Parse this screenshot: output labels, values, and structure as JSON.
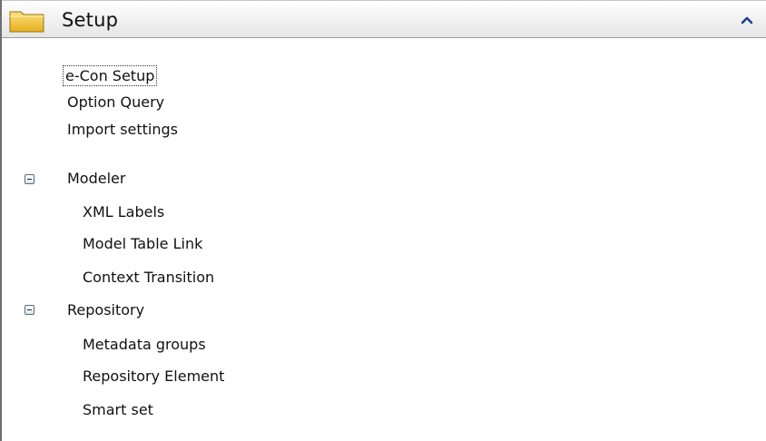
{
  "panel": {
    "title": "Setup",
    "collapse_icon": "chevron-up-icon",
    "folder_icon": "folder-icon"
  },
  "tree": {
    "items": [
      {
        "label": "e-Con Setup",
        "level": 1,
        "focused": true
      },
      {
        "label": "Option Query",
        "level": 1
      },
      {
        "label": "Import settings",
        "level": 1
      },
      {
        "label": "Modeler",
        "level": 1,
        "expanded": true
      },
      {
        "label": "XML Labels",
        "level": 2
      },
      {
        "label": "Model Table Link",
        "level": 2
      },
      {
        "label": "Context Transition",
        "level": 2
      },
      {
        "label": "Repository",
        "level": 1,
        "expanded": true
      },
      {
        "label": "Metadata groups",
        "level": 2
      },
      {
        "label": "Repository Element",
        "level": 2
      },
      {
        "label": "Smart set",
        "level": 2
      }
    ]
  },
  "colors": {
    "text": "#111111",
    "header_top": "#ffffff",
    "header_bottom": "#e6e6e6",
    "folder": "#f0c030",
    "expander_border": "#5a6b7e"
  }
}
